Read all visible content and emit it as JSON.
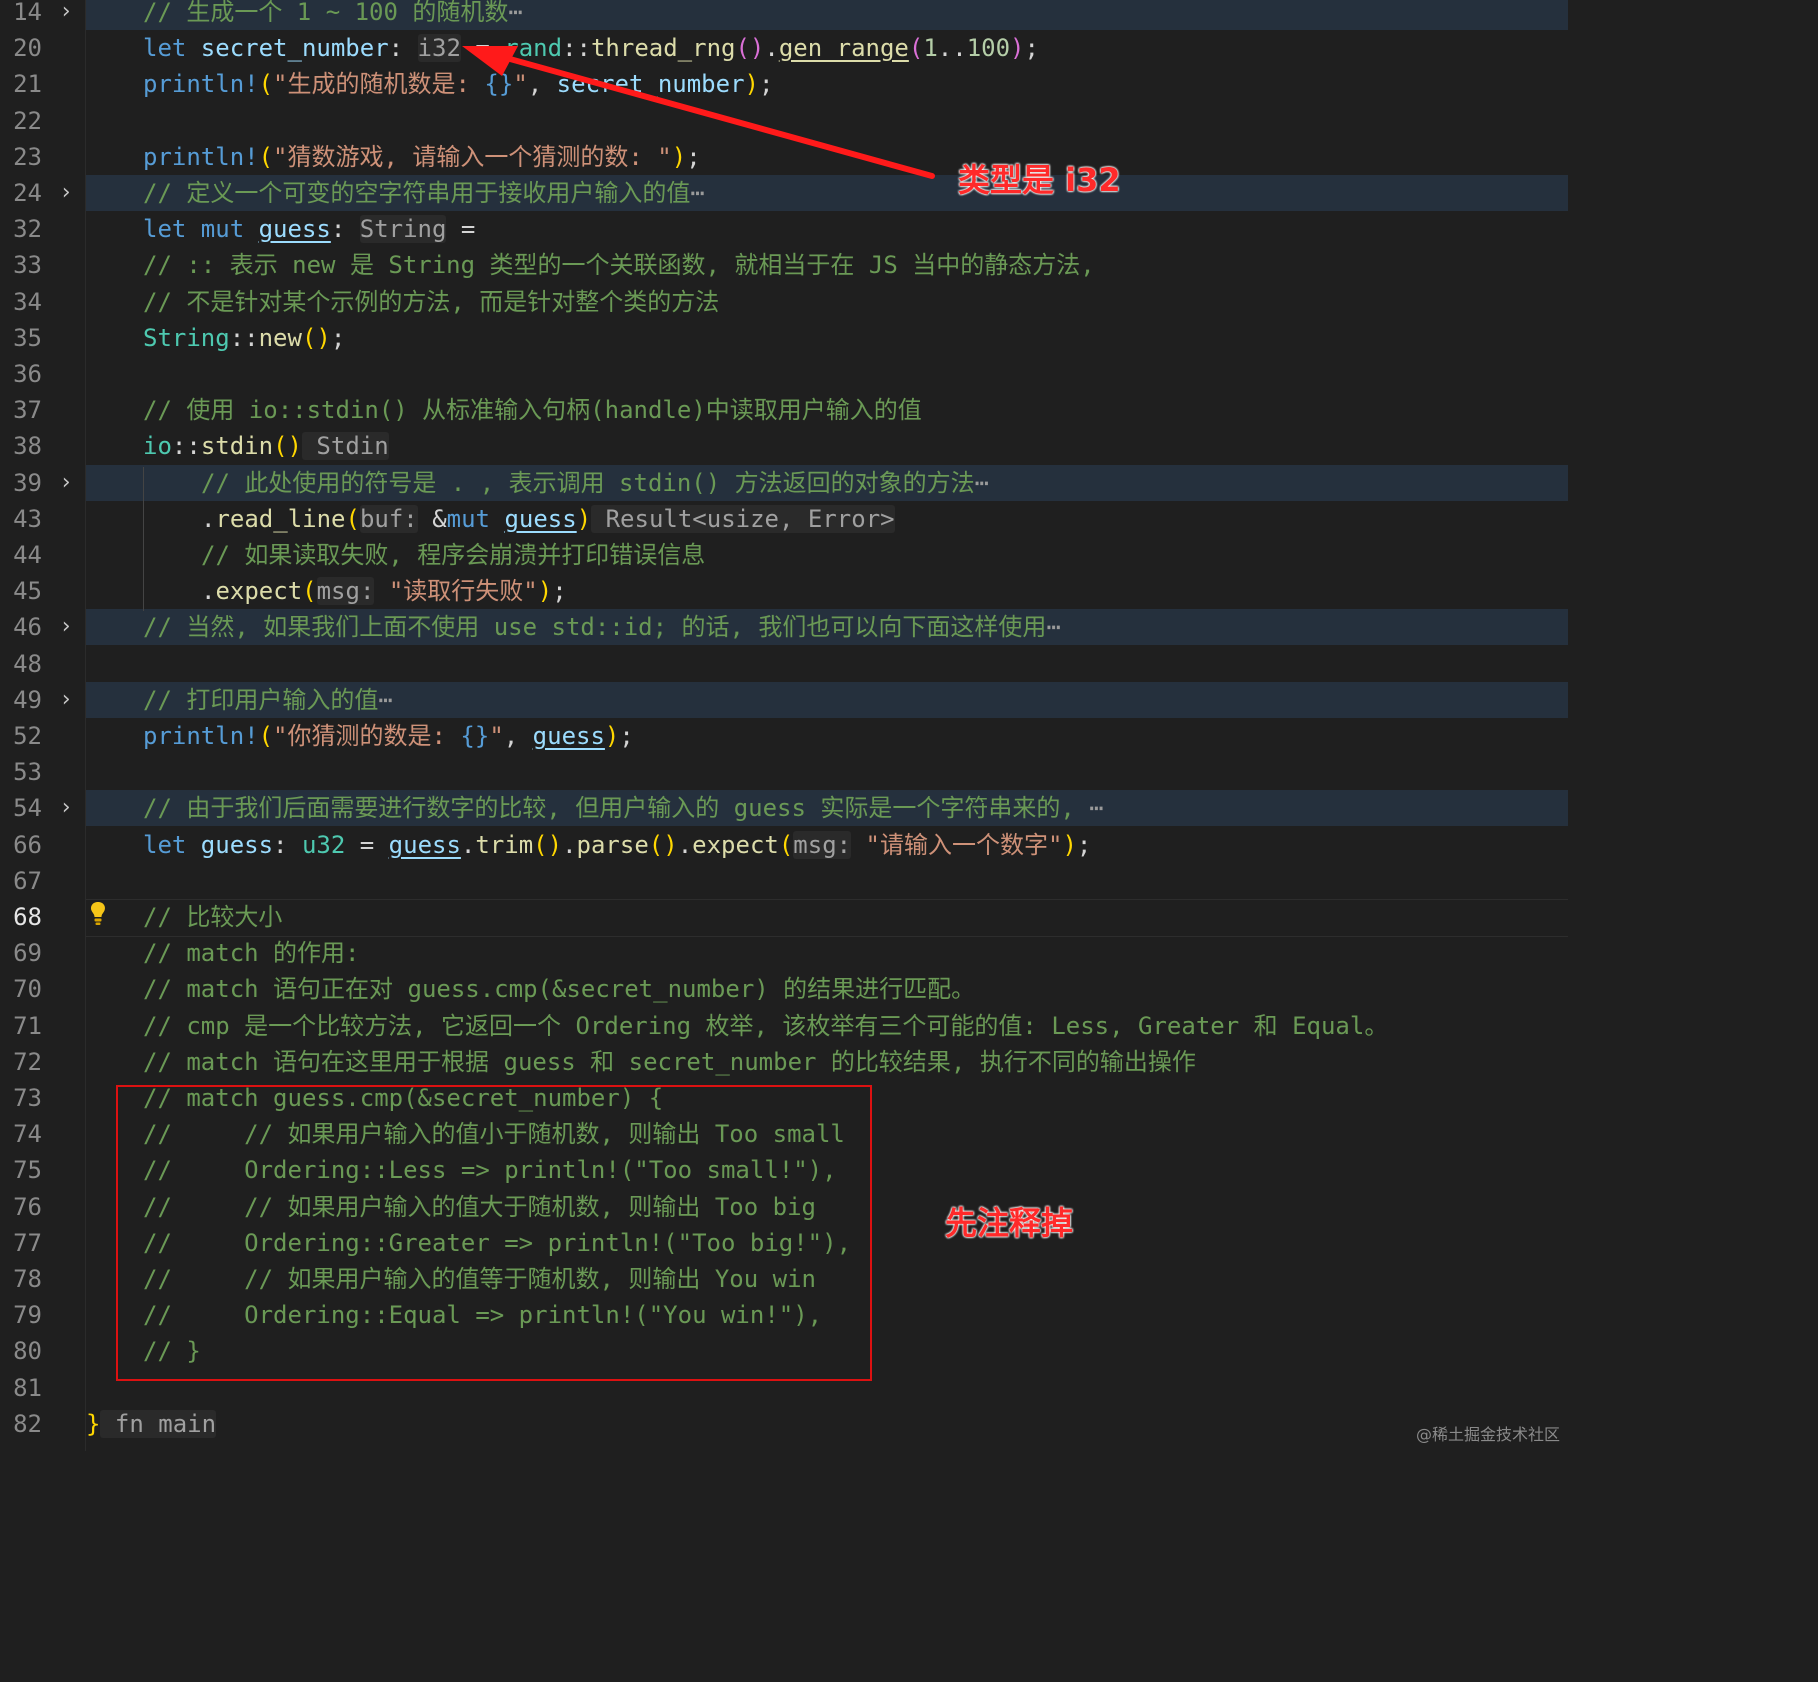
{
  "lines": [
    {
      "n": "14",
      "fold": true,
      "tokens": [
        [
          "c-com",
          "// 生成一个 1 ~ 100 的随机数"
        ],
        [
          "ellipsis",
          "⋯"
        ]
      ]
    },
    {
      "n": "20",
      "tokens": [
        [
          "c-kw",
          "let "
        ],
        [
          "c-var",
          "secret_number"
        ],
        [
          "c-punc",
          ": "
        ],
        [
          "c-hint",
          "i32"
        ],
        [
          "c-punc",
          " = "
        ],
        [
          "c-type",
          "rand"
        ],
        [
          "c-punc",
          "::"
        ],
        [
          "c-fn",
          "thread_rng"
        ],
        [
          "c-par",
          "()"
        ],
        [
          "c-punc",
          "."
        ],
        [
          "c-fn u",
          "gen_range"
        ],
        [
          "c-par",
          "("
        ],
        [
          "c-num",
          "1"
        ],
        [
          "c-punc",
          ".."
        ],
        [
          "c-num",
          "100"
        ],
        [
          "c-par",
          ")"
        ],
        [
          "c-punc",
          ";"
        ]
      ]
    },
    {
      "n": "21",
      "tokens": [
        [
          "c-mac",
          "println!"
        ],
        [
          "c-brk",
          "("
        ],
        [
          "c-str",
          "\"生成的随机数是: "
        ],
        [
          "c-kw",
          "{}"
        ],
        [
          "c-str",
          "\""
        ],
        [
          "c-punc",
          ", "
        ],
        [
          "c-var",
          "secret_number"
        ],
        [
          "c-brk",
          ")"
        ],
        [
          "c-punc",
          ";"
        ]
      ]
    },
    {
      "n": "22",
      "tokens": []
    },
    {
      "n": "23",
      "tokens": [
        [
          "c-mac",
          "println!"
        ],
        [
          "c-brk",
          "("
        ],
        [
          "c-str",
          "\"猜数游戏, 请输入一个猜测的数: \""
        ],
        [
          "c-brk",
          ")"
        ],
        [
          "c-punc",
          ";"
        ]
      ]
    },
    {
      "n": "24",
      "fold": true,
      "tokens": [
        [
          "c-com",
          "// 定义一个可变的空字符串用于接收用户输入的值"
        ],
        [
          "ellipsis",
          "⋯"
        ]
      ]
    },
    {
      "n": "32",
      "tokens": [
        [
          "c-kw",
          "let mut "
        ],
        [
          "c-var u",
          "guess"
        ],
        [
          "c-punc",
          ": "
        ],
        [
          "c-hint",
          "String"
        ],
        [
          "c-punc",
          " ="
        ]
      ]
    },
    {
      "n": "33",
      "tokens": [
        [
          "c-com",
          "// :: 表示 new 是 String 类型的一个关联函数, 就相当于在 JS 当中的静态方法,"
        ]
      ]
    },
    {
      "n": "34",
      "tokens": [
        [
          "c-com",
          "// 不是针对某个示例的方法, 而是针对整个类的方法"
        ]
      ]
    },
    {
      "n": "35",
      "tokens": [
        [
          "c-type",
          "String"
        ],
        [
          "c-punc",
          "::"
        ],
        [
          "c-fn",
          "new"
        ],
        [
          "c-brk",
          "()"
        ],
        [
          "c-punc",
          ";"
        ]
      ]
    },
    {
      "n": "36",
      "tokens": []
    },
    {
      "n": "37",
      "tokens": [
        [
          "c-com",
          "// 使用 io::stdin() 从标准输入句柄(handle)中读取用户输入的值"
        ]
      ]
    },
    {
      "n": "38",
      "tokens": [
        [
          "c-type",
          "io"
        ],
        [
          "c-punc",
          "::"
        ],
        [
          "c-fn",
          "stdin"
        ],
        [
          "c-brk",
          "()"
        ],
        [
          "c-hint",
          " Stdin"
        ]
      ]
    },
    {
      "n": "39",
      "fold": true,
      "indent": 1,
      "tokens": [
        [
          "c-com",
          "// 此处使用的符号是 . , 表示调用 stdin() 方法返回的对象的方法"
        ],
        [
          "ellipsis",
          "⋯"
        ]
      ]
    },
    {
      "n": "43",
      "indent": 1,
      "tokens": [
        [
          "c-punc",
          "."
        ],
        [
          "c-fn",
          "read_line"
        ],
        [
          "c-brk",
          "("
        ],
        [
          "c-hint",
          "buf:"
        ],
        [
          "c-punc",
          " &"
        ],
        [
          "c-kw",
          "mut "
        ],
        [
          "c-var u",
          "guess"
        ],
        [
          "c-brk",
          ")"
        ],
        [
          "c-hint",
          " Result<usize, Error>"
        ]
      ]
    },
    {
      "n": "44",
      "indent": 1,
      "tokens": [
        [
          "c-com",
          "// 如果读取失败, 程序会崩溃并打印错误信息"
        ]
      ]
    },
    {
      "n": "45",
      "indent": 1,
      "tokens": [
        [
          "c-punc",
          "."
        ],
        [
          "c-fn",
          "expect"
        ],
        [
          "c-brk",
          "("
        ],
        [
          "c-hint",
          "msg:"
        ],
        [
          "c-str",
          " \"读取行失败\""
        ],
        [
          "c-brk",
          ")"
        ],
        [
          "c-punc",
          ";"
        ]
      ]
    },
    {
      "n": "46",
      "fold": true,
      "tokens": [
        [
          "c-com",
          "// 当然, 如果我们上面不使用 use std::id; 的话, 我们也可以向下面这样使用"
        ],
        [
          "ellipsis",
          "⋯"
        ]
      ]
    },
    {
      "n": "48",
      "tokens": []
    },
    {
      "n": "49",
      "fold": true,
      "tokens": [
        [
          "c-com",
          "// 打印用户输入的值"
        ],
        [
          "ellipsis",
          "⋯"
        ]
      ]
    },
    {
      "n": "52",
      "tokens": [
        [
          "c-mac",
          "println!"
        ],
        [
          "c-brk",
          "("
        ],
        [
          "c-str",
          "\"你猜测的数是: "
        ],
        [
          "c-kw",
          "{}"
        ],
        [
          "c-str",
          "\""
        ],
        [
          "c-punc",
          ", "
        ],
        [
          "c-var u",
          "guess"
        ],
        [
          "c-brk",
          ")"
        ],
        [
          "c-punc",
          ";"
        ]
      ]
    },
    {
      "n": "53",
      "tokens": []
    },
    {
      "n": "54",
      "fold": true,
      "tokens": [
        [
          "c-com",
          "// 由于我们后面需要进行数字的比较, 但用户输入的 guess 实际是一个字符串来的, "
        ],
        [
          "ellipsis",
          "⋯"
        ]
      ]
    },
    {
      "n": "66",
      "tokens": [
        [
          "c-kw",
          "let "
        ],
        [
          "c-var",
          "guess"
        ],
        [
          "c-punc",
          ": "
        ],
        [
          "c-type",
          "u32"
        ],
        [
          "c-punc",
          " = "
        ],
        [
          "c-var u",
          "guess"
        ],
        [
          "c-punc",
          "."
        ],
        [
          "c-fn",
          "trim"
        ],
        [
          "c-brk",
          "()"
        ],
        [
          "c-punc",
          "."
        ],
        [
          "c-fn",
          "parse"
        ],
        [
          "c-brk",
          "()"
        ],
        [
          "c-punc",
          "."
        ],
        [
          "c-fn",
          "expect"
        ],
        [
          "c-brk",
          "("
        ],
        [
          "c-hint",
          "msg:"
        ],
        [
          "c-str",
          " \"请输入一个数字\""
        ],
        [
          "c-brk",
          ")"
        ],
        [
          "c-punc",
          ";"
        ]
      ]
    },
    {
      "n": "67",
      "tokens": []
    },
    {
      "n": "68",
      "current": true,
      "tokens": [
        [
          "c-com",
          "// 比较大小"
        ]
      ]
    },
    {
      "n": "69",
      "tokens": [
        [
          "c-com",
          "// match 的作用:"
        ]
      ]
    },
    {
      "n": "70",
      "tokens": [
        [
          "c-com",
          "// match 语句正在对 guess.cmp(&secret_number) 的结果进行匹配。"
        ]
      ]
    },
    {
      "n": "71",
      "tokens": [
        [
          "c-com",
          "// cmp 是一个比较方法, 它返回一个 Ordering 枚举, 该枚举有三个可能的值: Less, Greater 和 Equal。"
        ]
      ]
    },
    {
      "n": "72",
      "tokens": [
        [
          "c-com",
          "// match 语句在这里用于根据 guess 和 secret_number 的比较结果, 执行不同的输出操作"
        ]
      ]
    },
    {
      "n": "73",
      "tokens": [
        [
          "c-com",
          "// match guess.cmp(&secret_number) {"
        ]
      ]
    },
    {
      "n": "74",
      "tokens": [
        [
          "c-com",
          "//     // 如果用户输入的值小于随机数, 则输出 Too small"
        ]
      ]
    },
    {
      "n": "75",
      "tokens": [
        [
          "c-com",
          "//     Ordering::Less => println!(\"Too small!\"),"
        ]
      ]
    },
    {
      "n": "76",
      "tokens": [
        [
          "c-com",
          "//     // 如果用户输入的值大于随机数, 则输出 Too big"
        ]
      ]
    },
    {
      "n": "77",
      "tokens": [
        [
          "c-com",
          "//     Ordering::Greater => println!(\"Too big!\"),"
        ]
      ]
    },
    {
      "n": "78",
      "tokens": [
        [
          "c-com",
          "//     // 如果用户输入的值等于随机数, 则输出 You win"
        ]
      ]
    },
    {
      "n": "79",
      "tokens": [
        [
          "c-com",
          "//     Ordering::Equal => println!(\"You win!\"),"
        ]
      ]
    },
    {
      "n": "80",
      "tokens": [
        [
          "c-com",
          "// }"
        ]
      ]
    },
    {
      "n": "81",
      "tokens": []
    },
    {
      "n": "82",
      "outdent": true,
      "tokens": [
        [
          "c-brk",
          "}"
        ],
        [
          "c-hint",
          " fn main"
        ]
      ]
    }
  ],
  "annotations": {
    "type_note": "类型是 i32",
    "comment_out_note": "先注释掉",
    "arrow_color": "#ff1a1a"
  },
  "watermark": "@稀土掘金技术社区",
  "icons": {
    "fold": "chevron-right-icon",
    "bulb": "lightbulb-icon"
  }
}
